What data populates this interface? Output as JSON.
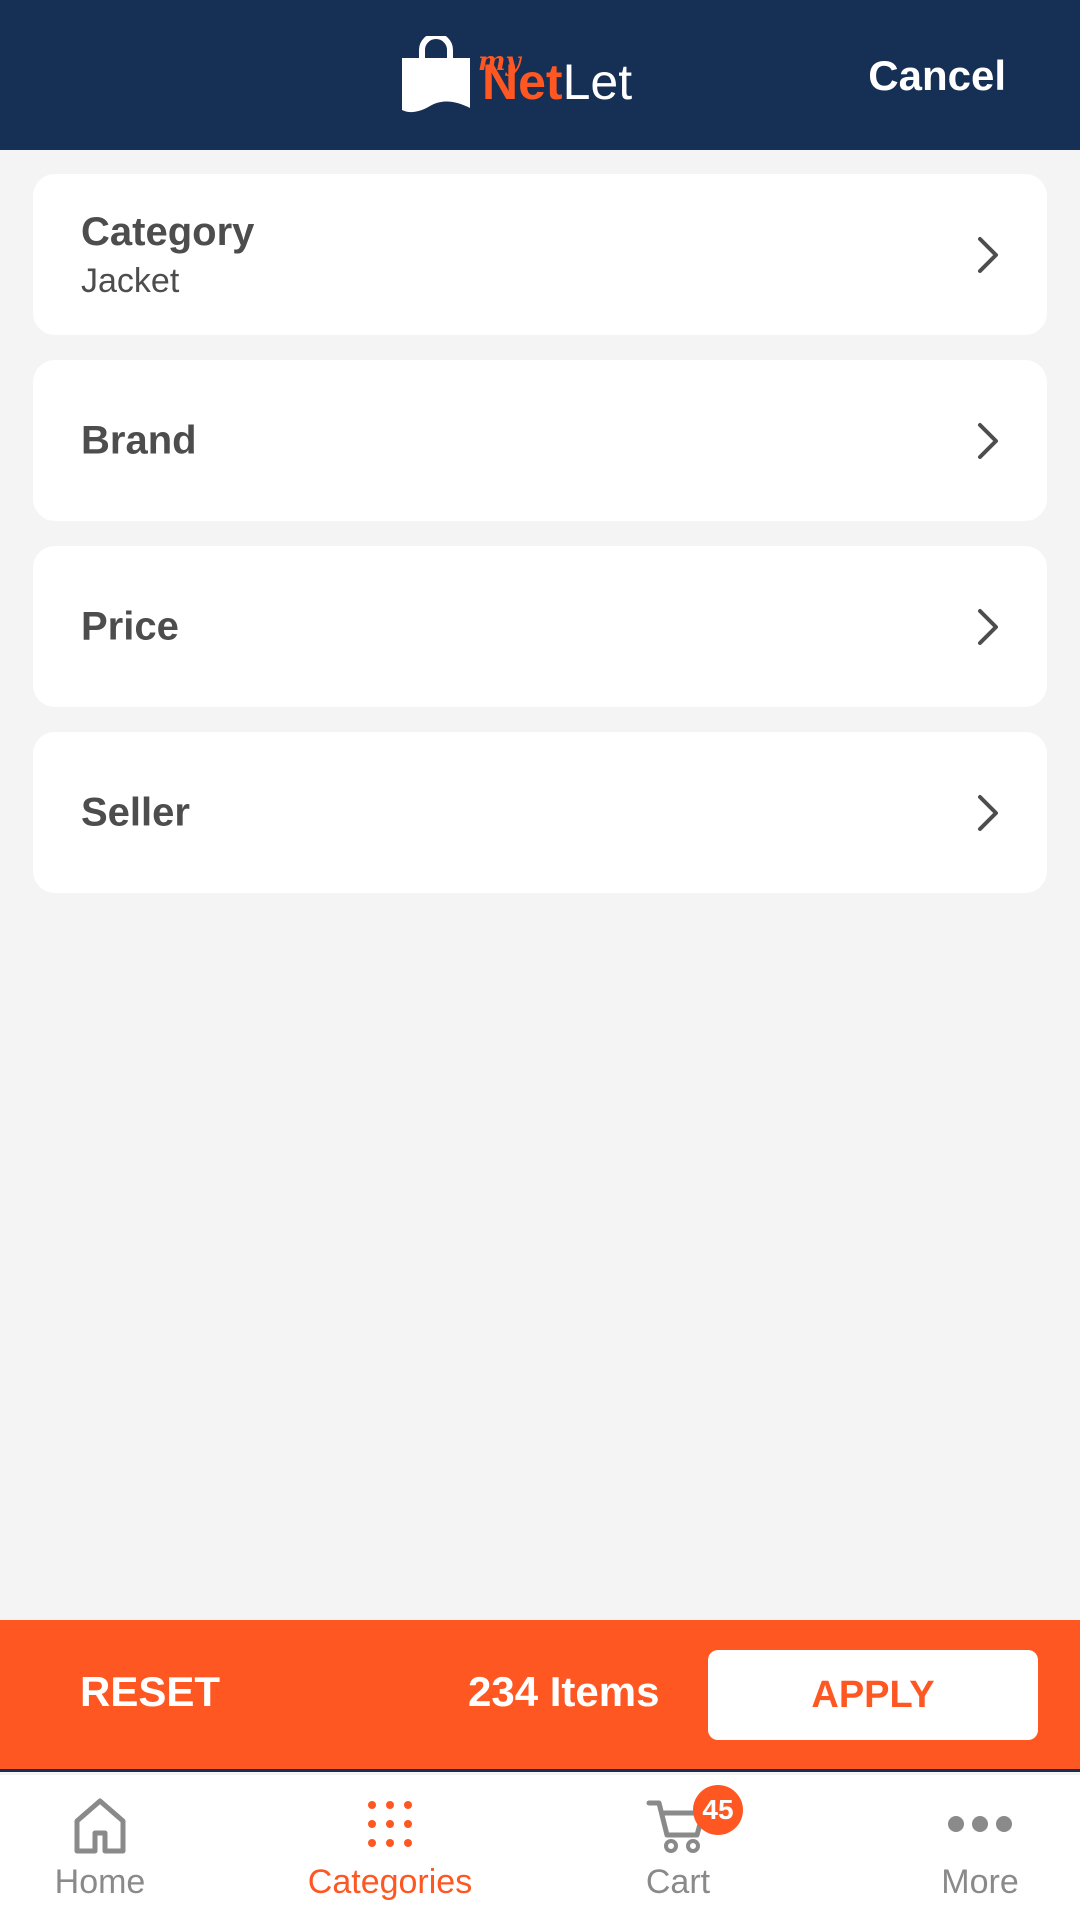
{
  "header": {
    "logo_my": "my",
    "logo_net": "Net",
    "logo_let": "Let",
    "cancel_label": "Cancel"
  },
  "filters": [
    {
      "label": "Category",
      "value": "Jacket"
    },
    {
      "label": "Brand",
      "value": ""
    },
    {
      "label": "Price",
      "value": ""
    },
    {
      "label": "Seller",
      "value": ""
    }
  ],
  "action_bar": {
    "reset_label": "RESET",
    "items_count": "234 Items",
    "apply_label": "APPLY"
  },
  "tabbar": {
    "home": "Home",
    "categories": "Categories",
    "cart": "Cart",
    "cart_badge": "45",
    "more": "More"
  },
  "colors": {
    "header_bg": "#152f55",
    "accent": "#ff5722",
    "page_bg": "#f4f4f4",
    "text_dark": "#4d4d4d",
    "tab_inactive": "#8a8a8a"
  },
  "icons": {
    "logo": "shopping-bag-icon",
    "row_chevron": "chevron-right-icon",
    "home": "home-icon",
    "categories": "grid-dots-icon",
    "cart": "cart-icon",
    "more": "more-dots-icon"
  }
}
